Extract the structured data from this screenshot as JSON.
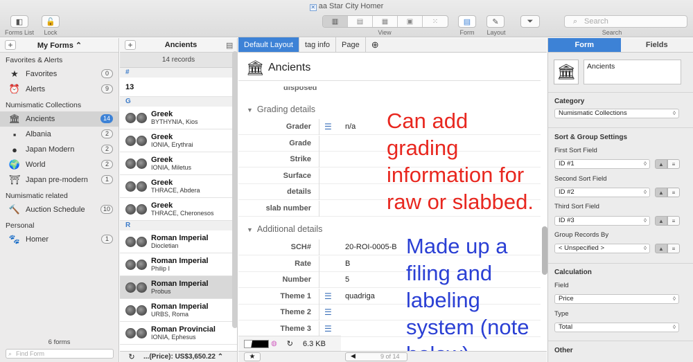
{
  "window": {
    "title": "aa Star City Homer",
    "doc_icon": "✕"
  },
  "toolbar": {
    "forms_list_label": "Forms List",
    "lock_label": "Lock",
    "view_label": "View",
    "form_label": "Form",
    "layout_label": "Layout",
    "search_label": "Search",
    "search_placeholder": "Search",
    "view_buttons": [
      "list-view-icon",
      "table-view-icon",
      "calendar-view-icon",
      "photo-view-icon",
      "grid-view-icon"
    ]
  },
  "sidebar": {
    "header": "My Forms ⌃",
    "sections": [
      {
        "label": "Favorites & Alerts",
        "items": [
          {
            "label": "Favorites",
            "count": "0",
            "icon": "★"
          },
          {
            "label": "Alerts",
            "count": "9",
            "icon": "⏰"
          }
        ]
      },
      {
        "label": "Numismatic Collections",
        "items": [
          {
            "label": "Ancients",
            "count": "14",
            "icon": "🏛"
          },
          {
            "label": "Albania",
            "count": "2",
            "icon": "▪"
          },
          {
            "label": "Japan Modern",
            "count": "2",
            "icon": "●"
          },
          {
            "label": "World",
            "count": "2",
            "icon": "🌍"
          },
          {
            "label": "Japan pre-modern",
            "count": "1",
            "icon": "⛩"
          }
        ]
      },
      {
        "label": "Numismatic related",
        "items": [
          {
            "label": "Auction Schedule",
            "count": "10",
            "icon": "🔨"
          }
        ]
      },
      {
        "label": "Personal",
        "items": [
          {
            "label": "Homer",
            "count": "1",
            "icon": "🐾"
          }
        ]
      }
    ],
    "footer_count": "6 forms",
    "find_placeholder": "Find Form"
  },
  "list": {
    "title": "Ancients",
    "record_count": "14 records",
    "sections": [
      {
        "letter": "#",
        "rows": [
          {
            "title": "13",
            "sub": ""
          }
        ]
      },
      {
        "letter": "G",
        "rows": [
          {
            "title": "Greek",
            "sub": "BYTHYNIA, Kios"
          },
          {
            "title": "Greek",
            "sub": "IONIA, Erythrai"
          },
          {
            "title": "Greek",
            "sub": "IONIA, Miletus"
          },
          {
            "title": "Greek",
            "sub": "THRACE, Abdera"
          },
          {
            "title": "Greek",
            "sub": "THRACE, Cheronesos"
          }
        ]
      },
      {
        "letter": "R",
        "rows": [
          {
            "title": "Roman Imperial",
            "sub": "Diocletian"
          },
          {
            "title": "Roman Imperial",
            "sub": "Philip I"
          },
          {
            "title": "Roman Imperial",
            "sub": "Probus"
          },
          {
            "title": "Roman Imperial",
            "sub": "URBS, Roma"
          },
          {
            "title": "Roman Provincial",
            "sub": "IONIA, Ephesus"
          }
        ]
      }
    ],
    "footer_total": "...(Price): US$3,650.22 ⌃"
  },
  "form": {
    "tabs": [
      "Default Layout",
      "tag info",
      "Page"
    ],
    "title": "Ancients",
    "cut_label": "disposed",
    "grading_section": "Grading details",
    "grading_fields": [
      {
        "label": "Grader",
        "value": "n/a",
        "list": true
      },
      {
        "label": "Grade",
        "value": "",
        "list": false
      },
      {
        "label": "Strike",
        "value": "",
        "list": false
      },
      {
        "label": "Surface",
        "value": "",
        "list": false
      },
      {
        "label": "details",
        "value": "",
        "list": false
      },
      {
        "label": "slab number",
        "value": "",
        "list": false
      }
    ],
    "additional_section": "Additional details",
    "additional_fields": [
      {
        "label": "SCH#",
        "value": "20-ROI-0005-B",
        "list": false
      },
      {
        "label": "Rate",
        "value": "B",
        "list": false
      },
      {
        "label": "Number",
        "value": "5",
        "list": false
      },
      {
        "label": "Theme 1",
        "value": "quadriga",
        "list": true
      },
      {
        "label": "Theme 2",
        "value": "",
        "list": true
      },
      {
        "label": "Theme 3",
        "value": "",
        "list": true
      }
    ],
    "file_size": "6.3 KB",
    "pager": "9 of 14",
    "annotation_red": [
      "Can add",
      "grading",
      "information for",
      "raw or slabbed."
    ],
    "annotation_blue": [
      "Made up a",
      "filing and",
      "labeling",
      "system (note",
      "below)"
    ],
    "colors": {
      "red": "#e8271f",
      "blue": "#2a3fd4",
      "accent": "#3d82d6"
    }
  },
  "inspector": {
    "tabs": [
      "Form",
      "Fields"
    ],
    "form_name": "Ancients",
    "category_label": "Category",
    "category_value": "Numismatic Collections",
    "sort_label": "Sort & Group Settings",
    "first_sort_label": "First Sort Field",
    "first_sort_value": "ID #1",
    "second_sort_label": "Second Sort Field",
    "second_sort_value": "ID #2",
    "third_sort_label": "Third Sort Field",
    "third_sort_value": "ID #3",
    "group_label": "Group Records By",
    "group_value": "< Unspecified >",
    "calc_label": "Calculation",
    "field_label": "Field",
    "field_value": "Price",
    "type_label": "Type",
    "type_value": "Total",
    "other_label": "Other"
  }
}
